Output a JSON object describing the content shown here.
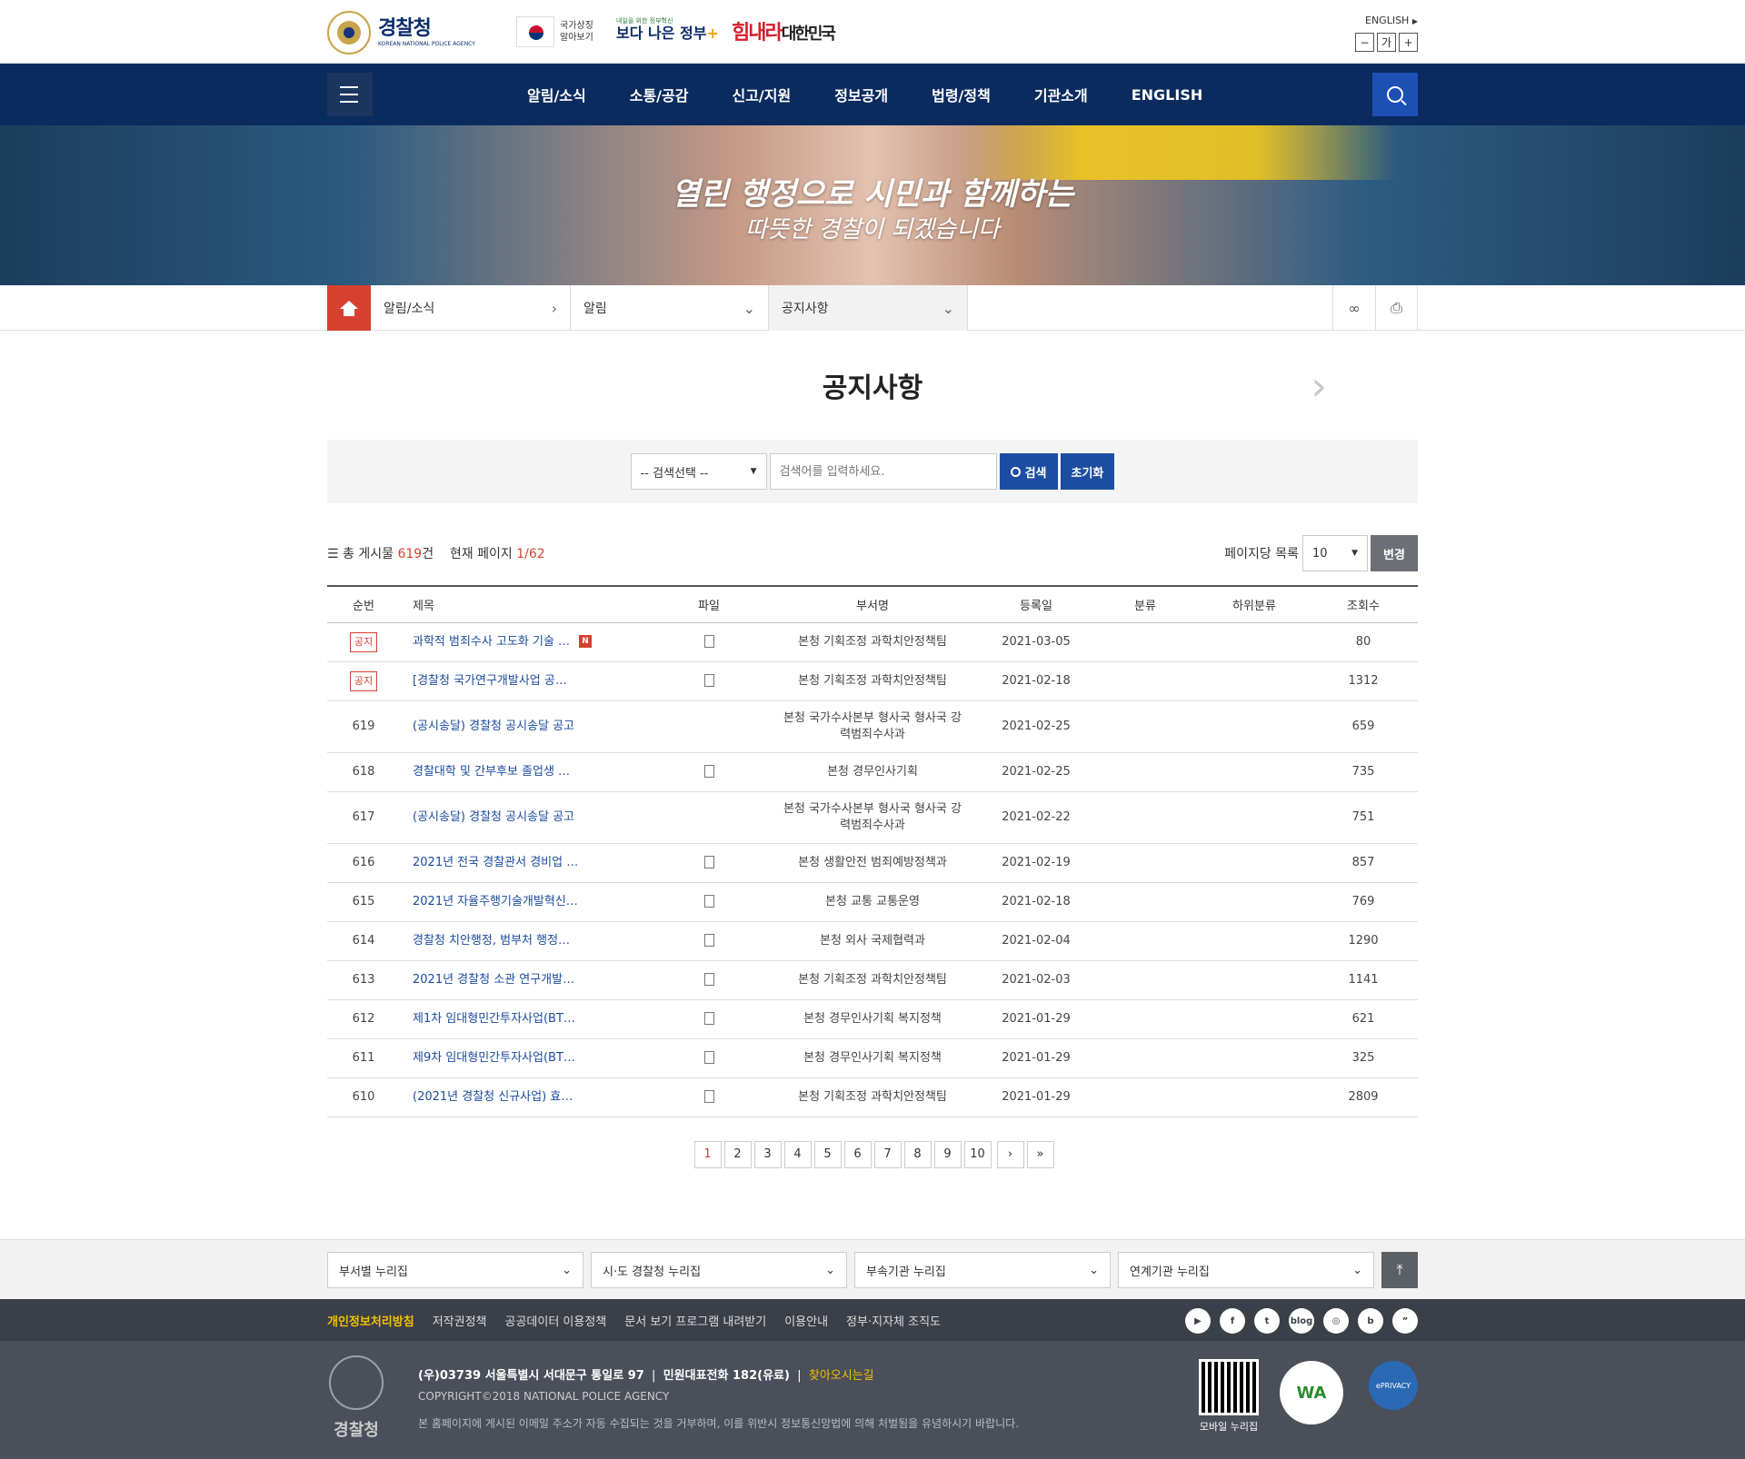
{
  "header": {
    "logo_ko": "경찰청",
    "logo_en": "KOREAN NATIONAL POLICE AGENCY",
    "gov_symbol": "국가상징 알아보기",
    "gov_slogan_small": "내일을 위한 정부혁신",
    "gov_slogan": "보다 나은 정부",
    "gov_slogan_plus": "+",
    "slogan2": "힘내라",
    "slogan2b": "대한민국",
    "english_link": "ENGLISH",
    "font_minus": "−",
    "font_label": "가",
    "font_plus": "+"
  },
  "nav": {
    "items": [
      "알림/소식",
      "소통/공감",
      "신고/지원",
      "정보공개",
      "법령/정책",
      "기관소개",
      "ENGLISH"
    ]
  },
  "banner": {
    "line1": "열린 행정으로 시민과 함께하는",
    "line2": "따뜻한 경찰이 되겠습니다"
  },
  "breadcrumb": {
    "level1": "알림/소식",
    "level2": "알림",
    "level3": "공지사항"
  },
  "page": {
    "title": "공지사항",
    "next": "›"
  },
  "search": {
    "select_label": "-- 검색선택 --",
    "placeholder": "검색어를 입력하세요.",
    "search_btn": "검색",
    "reset_btn": "초기화"
  },
  "summary": {
    "total_label": "총 게시물",
    "total": "619",
    "total_unit": "건",
    "page_label": "현재 페이지",
    "page_value": "1/62",
    "per_page_label": "페이지당 목록",
    "per_page_value": "10",
    "change_btn": "변경"
  },
  "table": {
    "headers": [
      "순번",
      "제목",
      "파일",
      "부서명",
      "등록일",
      "분류",
      "하위분류",
      "조회수"
    ],
    "rows": [
      {
        "no": "공지",
        "notice": true,
        "title": "과학적 범죄수사 고도화 기술 …",
        "new": "N",
        "file": true,
        "dept": "본청 기획조정 과학치안정책팀",
        "date": "2021-03-05",
        "views": "80"
      },
      {
        "no": "공지",
        "notice": true,
        "title": "[경찰청 국가연구개발사업 공…",
        "new": "",
        "file": true,
        "dept": "본청 기획조정 과학치안정책팀",
        "date": "2021-02-18",
        "views": "1312"
      },
      {
        "no": "619",
        "notice": false,
        "title": "(공시송달) 경찰청 공시송달 공고",
        "new": "",
        "file": false,
        "dept": "본청 국가수사본부 형사국 형사국 강력범죄수사과",
        "date": "2021-02-25",
        "views": "659"
      },
      {
        "no": "618",
        "notice": false,
        "title": "경찰대학 및 간부후보 졸업생 …",
        "new": "",
        "file": true,
        "dept": "본청 경무인사기획",
        "date": "2021-02-25",
        "views": "735"
      },
      {
        "no": "617",
        "notice": false,
        "title": "(공시송달) 경찰청 공시송달 공고",
        "new": "",
        "file": false,
        "dept": "본청 국가수사본부 형사국 형사국 강력범죄수사과",
        "date": "2021-02-22",
        "views": "751"
      },
      {
        "no": "616",
        "notice": false,
        "title": "2021년 전국 경찰관서 경비업 …",
        "new": "",
        "file": true,
        "dept": "본청 생활안전 범죄예방정책과",
        "date": "2021-02-19",
        "views": "857"
      },
      {
        "no": "615",
        "notice": false,
        "title": "2021년 자율주행기술개발혁신…",
        "new": "",
        "file": true,
        "dept": "본청 교통 교통운영",
        "date": "2021-02-18",
        "views": "769"
      },
      {
        "no": "614",
        "notice": false,
        "title": "경찰청 치안행정, 범부처 행정…",
        "new": "",
        "file": true,
        "dept": "본청 외사 국제협력과",
        "date": "2021-02-04",
        "views": "1290"
      },
      {
        "no": "613",
        "notice": false,
        "title": "2021년 경찰청 소관 연구개발…",
        "new": "",
        "file": true,
        "dept": "본청 기획조정 과학치안정책팀",
        "date": "2021-02-03",
        "views": "1141"
      },
      {
        "no": "612",
        "notice": false,
        "title": "제1차 임대형민간투자사업(BT…",
        "new": "",
        "file": true,
        "dept": "본청 경무인사기획 복지정책",
        "date": "2021-01-29",
        "views": "621"
      },
      {
        "no": "611",
        "notice": false,
        "title": "제9차 임대형민간투자사업(BT…",
        "new": "",
        "file": true,
        "dept": "본청 경무인사기획 복지정책",
        "date": "2021-01-29",
        "views": "325"
      },
      {
        "no": "610",
        "notice": false,
        "title": "(2021년 경찰청 신규사업) 효…",
        "new": "",
        "file": true,
        "dept": "본청 기획조정 과학치안정책팀",
        "date": "2021-01-29",
        "views": "2809"
      }
    ]
  },
  "pager": {
    "pages": [
      "1",
      "2",
      "3",
      "4",
      "5",
      "6",
      "7",
      "8",
      "9",
      "10"
    ],
    "current": "1",
    "next": "›",
    "last": "»"
  },
  "footer": {
    "selects": [
      "부서별 누리집",
      "시·도 경찰청 누리집",
      "부속기관 누리집",
      "연계기관 누리집"
    ],
    "links": [
      "개인정보처리방침",
      "저작권정책",
      "공공데이터 이용정책",
      "문서 보기 프로그램 내려받기",
      "이용안내",
      "정부·지자체 조직도"
    ],
    "sns": [
      "▶",
      "f",
      "t",
      "blog",
      "◎",
      "b",
      "”"
    ],
    "emblem_text": "경찰청",
    "address": "(우)03739 서울특별시 서대문구 통일로 97",
    "phone": "민원대표전화 182(유료)",
    "directions": "찾아오시는길",
    "copyright": "COPYRIGHT©2018 NATIONAL POLICE AGENCY",
    "warning": "본 홈페이지에 게시된 이메일 주소가 자동 수집되는 것을 거부하며, 이를 위반시 정보통신망법에 의해 처벌됨을 유념하시기 바랍니다.",
    "qr_label": "모바일 누리집",
    "wa_label": "WA",
    "privacy_label": "ePRIVACY"
  }
}
